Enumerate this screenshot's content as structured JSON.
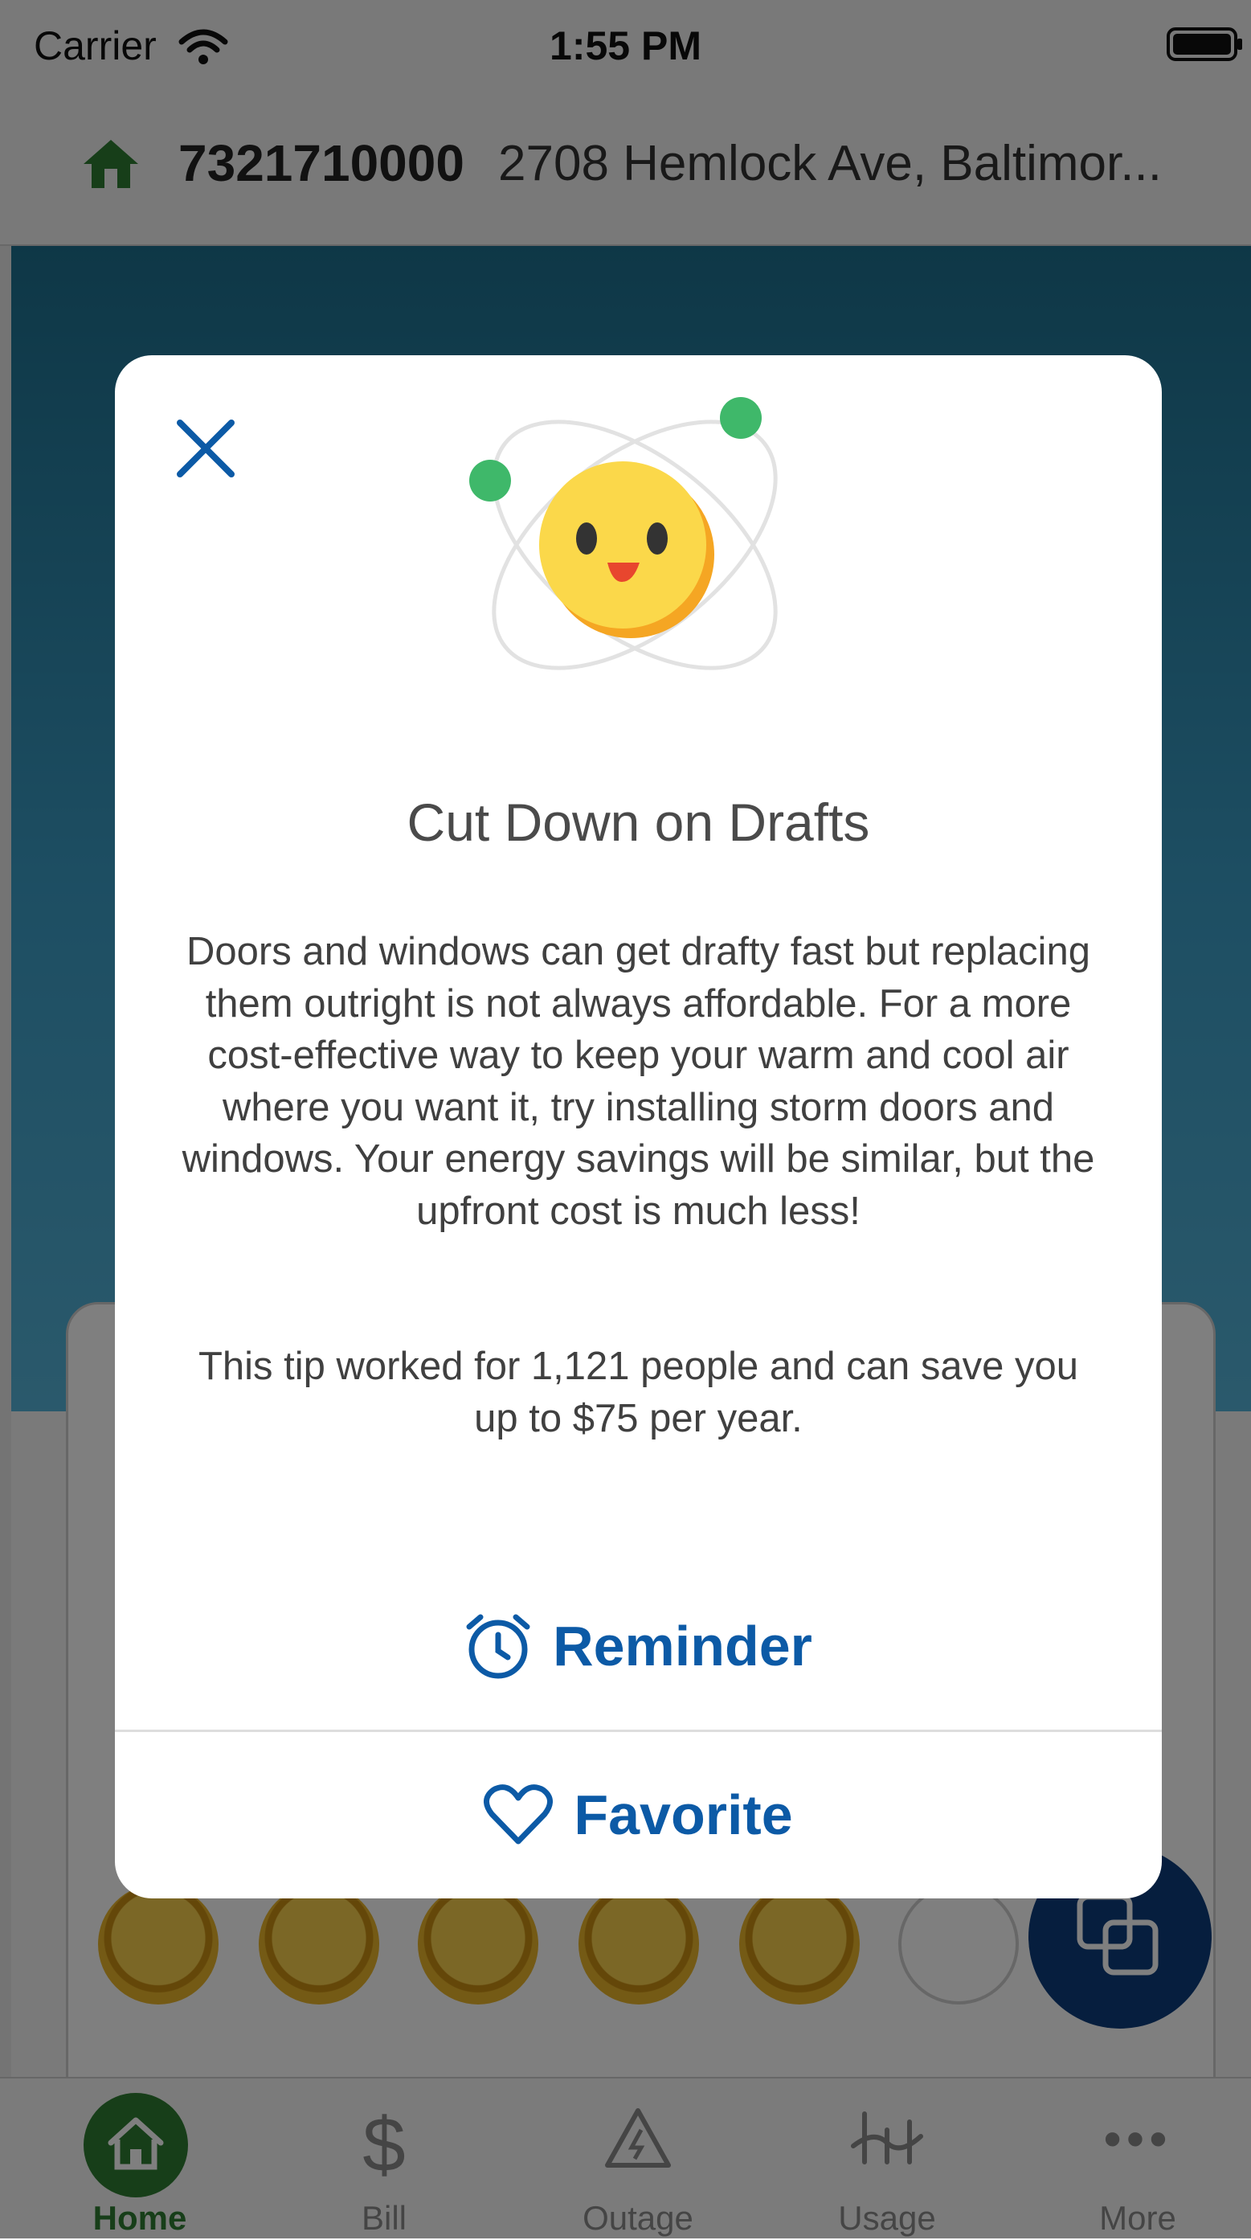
{
  "status_bar": {
    "carrier": "Carrier",
    "time": "1:55 PM"
  },
  "header": {
    "account_number": "7321710000",
    "address": "2708 Hemlock Ave, Baltimor..."
  },
  "modal": {
    "title": "Cut Down on Drafts",
    "body": "Doors and windows can get drafty fast but replacing them outright is not always affordable. For a more cost-effective way to keep your warm and cool air where you want it, try installing storm doors and windows. Your energy savings will be similar, but the upfront cost is much less!",
    "stats": "This tip worked for 1,121 people and can save you up to $75 per year.",
    "reminder_label": "Reminder",
    "favorite_label": "Favorite"
  },
  "tab_bar": {
    "items": [
      {
        "label": "Home",
        "icon": "home-icon",
        "active": true
      },
      {
        "label": "Bill",
        "icon": "dollar-icon",
        "active": false
      },
      {
        "label": "Outage",
        "icon": "outage-icon",
        "active": false
      },
      {
        "label": "Usage",
        "icon": "usage-icon",
        "active": false
      },
      {
        "label": "More",
        "icon": "more-icon",
        "active": false
      }
    ]
  },
  "colors": {
    "accent": "#0c5aa6",
    "home_active": "#2e7d32",
    "fab": "#0c3c7c",
    "coin": "#e8b52b"
  }
}
